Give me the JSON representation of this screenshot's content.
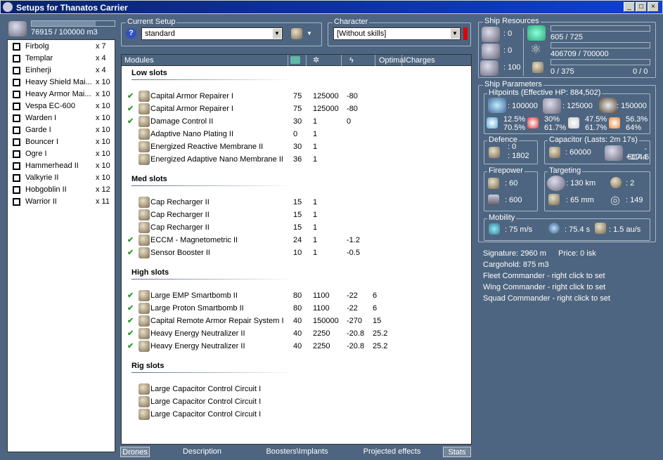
{
  "window": {
    "title": "Setups for Thanatos Carrier",
    "min": "_",
    "max": "□",
    "close": "×"
  },
  "drone_bay": {
    "capacity": "76915 / 100000 m3",
    "fill": 0.769,
    "drones": [
      {
        "name": "Firbolg",
        "qty": "x 7"
      },
      {
        "name": "Templar",
        "qty": "x 4"
      },
      {
        "name": "Einherji",
        "qty": "x 4"
      },
      {
        "name": "Heavy Shield Mai...",
        "qty": "x 10"
      },
      {
        "name": "Heavy Armor Mai...",
        "qty": "x 10"
      },
      {
        "name": "Vespa EC-600",
        "qty": "x 10"
      },
      {
        "name": "Warden I",
        "qty": "x 10"
      },
      {
        "name": "Garde I",
        "qty": "x 10"
      },
      {
        "name": "Bouncer I",
        "qty": "x 10"
      },
      {
        "name": "Ogre I",
        "qty": "x 10"
      },
      {
        "name": "Hammerhead II",
        "qty": "x 10"
      },
      {
        "name": "Valkyrie II",
        "qty": "x 10"
      },
      {
        "name": "Hobgoblin II",
        "qty": "x 12"
      },
      {
        "name": "Warrior II",
        "qty": "x 11"
      }
    ]
  },
  "current_setup": {
    "label": "Current Setup",
    "value": "standard",
    "help": "?"
  },
  "character": {
    "label": "Character",
    "value": "[Without skills]",
    "status_color": "#e00000"
  },
  "modules_table": {
    "columns": [
      "Modules",
      "",
      "",
      "",
      "Optimal",
      "Charges"
    ],
    "sections": [
      {
        "title": "Low slots",
        "rows": [
          {
            "active": true,
            "name": "Capital Armor Repairer I",
            "cpu": "75",
            "pg": "125000",
            "cap": "-80",
            "optimal": ""
          },
          {
            "active": true,
            "name": "Capital Armor Repairer I",
            "cpu": "75",
            "pg": "125000",
            "cap": "-80",
            "optimal": ""
          },
          {
            "active": true,
            "name": "Damage Control II",
            "cpu": "30",
            "pg": "1",
            "cap": "0",
            "optimal": ""
          },
          {
            "active": false,
            "name": "Adaptive Nano Plating II",
            "cpu": "0",
            "pg": "1",
            "cap": "",
            "optimal": ""
          },
          {
            "active": false,
            "name": "Energized Reactive Membrane II",
            "cpu": "30",
            "pg": "1",
            "cap": "",
            "optimal": ""
          },
          {
            "active": false,
            "name": "Energized Adaptive Nano Membrane II",
            "cpu": "36",
            "pg": "1",
            "cap": "",
            "optimal": ""
          }
        ]
      },
      {
        "title": "Med slots",
        "rows": [
          {
            "active": false,
            "name": "Cap Recharger II",
            "cpu": "15",
            "pg": "1",
            "cap": "",
            "optimal": ""
          },
          {
            "active": false,
            "name": "Cap Recharger II",
            "cpu": "15",
            "pg": "1",
            "cap": "",
            "optimal": ""
          },
          {
            "active": false,
            "name": "Cap Recharger II",
            "cpu": "15",
            "pg": "1",
            "cap": "",
            "optimal": ""
          },
          {
            "active": true,
            "name": "ECCM - Magnetometric II",
            "cpu": "24",
            "pg": "1",
            "cap": "-1.2",
            "optimal": ""
          },
          {
            "active": true,
            "name": "Sensor Booster II",
            "cpu": "10",
            "pg": "1",
            "cap": "-0.5",
            "optimal": ""
          }
        ]
      },
      {
        "title": "High slots",
        "rows": [
          {
            "active": true,
            "name": "Large EMP Smartbomb II",
            "cpu": "80",
            "pg": "1100",
            "cap": "-22",
            "optimal": "6"
          },
          {
            "active": true,
            "name": "Large Proton Smartbomb II",
            "cpu": "80",
            "pg": "1100",
            "cap": "-22",
            "optimal": "6"
          },
          {
            "active": true,
            "name": "Capital Remote Armor Repair System I",
            "cpu": "40",
            "pg": "150000",
            "cap": "-270",
            "optimal": "15"
          },
          {
            "active": true,
            "name": "Heavy Energy Neutralizer II",
            "cpu": "40",
            "pg": "2250",
            "cap": "-20.8",
            "optimal": "25.2"
          },
          {
            "active": true,
            "name": "Heavy Energy Neutralizer II",
            "cpu": "40",
            "pg": "2250",
            "cap": "-20.8",
            "optimal": "25.2"
          }
        ]
      },
      {
        "title": "Rig slots",
        "rows": [
          {
            "active": false,
            "name": "Large Capacitor Control Circuit I",
            "cpu": "",
            "pg": "",
            "cap": "",
            "optimal": ""
          },
          {
            "active": false,
            "name": "Large Capacitor Control Circuit I",
            "cpu": "",
            "pg": "",
            "cap": "",
            "optimal": ""
          },
          {
            "active": false,
            "name": "Large Capacitor Control Circuit I",
            "cpu": "",
            "pg": "",
            "cap": "",
            "optimal": ""
          }
        ]
      }
    ]
  },
  "tabs": [
    "Drones",
    "Description",
    "Boosters\\Implants",
    "Projected effects",
    "Stats"
  ],
  "ship_resources": {
    "label": "Ship Resources",
    "turrets": ": 0",
    "launchers": ": 0",
    "drone_bw": ": 100",
    "cpu": "605 / 725",
    "cpu_fill": 0.834,
    "powergrid": "406709 / 700000",
    "pg_fill": 0.581,
    "calibration": "0 / 375",
    "cal_fill": 0,
    "rigs": "0 / 0"
  },
  "ship_parameters": {
    "label": "Ship Parameters",
    "hitpoints": {
      "label": "Hitpoints (Effective HP: 884,502)",
      "shield": ": 100000",
      "armor": ": 125000",
      "structure": ": 150000",
      "resists": [
        {
          "top": "12.5%",
          "bottom": "70.5%"
        },
        {
          "top": "30%",
          "bottom": "61.7%"
        },
        {
          "top": "47.5%",
          "bottom": "61.7%"
        },
        {
          "top": "56.3%",
          "bottom": "64%"
        }
      ]
    },
    "defence": {
      "label": "Defence",
      "a": ": 0",
      "b": ": 1802"
    },
    "capacitor": {
      "label": "Capacitor (Lasts: 2m 17s)",
      "capacity": ": 60000",
      "use": "- 517.4",
      "recharge": "+114.6"
    },
    "firepower": {
      "label": "Firepower",
      "a": ": 60",
      "b": ": 600"
    },
    "targeting": {
      "label": "Targeting",
      "range": ": 130 km",
      "res": ": 65 mm",
      "targets": ": 2",
      "sensor": ": 149"
    },
    "mobility": {
      "label": "Mobility",
      "speed": ": 75 m/s",
      "align": ": 75.4 s",
      "warp": ": 1.5 au/s"
    },
    "signature": "Signature: 2960 m",
    "price": "Price: 0 isk",
    "cargo": "Cargohold: 875 m3",
    "fleet": "Fleet Commander - right click to set",
    "wing": "Wing Commander - right click to set",
    "squad": "Squad Commander - right click to set"
  }
}
